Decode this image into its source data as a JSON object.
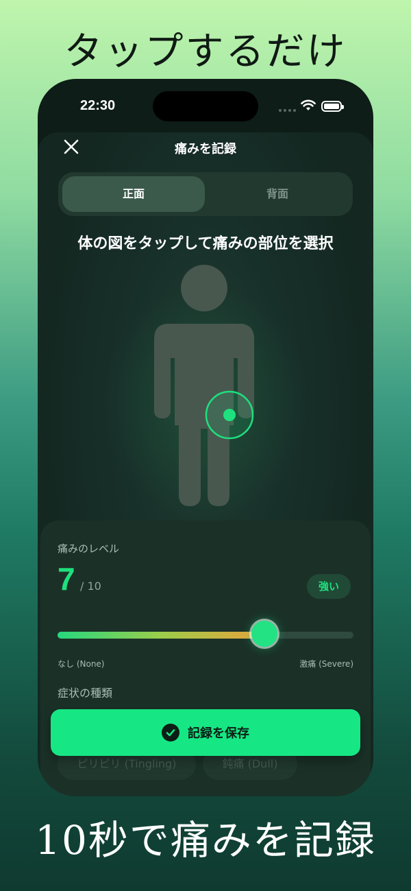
{
  "headline_top": "タップするだけ",
  "headline_bottom": "10秒で痛みを記録",
  "status_bar": {
    "time": "22:30"
  },
  "sheet": {
    "title": "痛みを記録",
    "close_icon": "close-icon"
  },
  "view_toggle": {
    "front_label": "正面",
    "back_label": "背面",
    "selected": "正面"
  },
  "instruction": "体の図をタップして痛みの部位を選択",
  "pain_level": {
    "label": "痛みのレベル",
    "value": "7",
    "max_text": "/ 10",
    "badge": "強い",
    "fraction": 0.7,
    "min_label": "なし (None)",
    "max_label": "激痛 (Severe)"
  },
  "symptoms": {
    "label": "症状の種類",
    "chips": [
      "ピリピリ (Tingling)",
      "鈍痛 (Dull)"
    ]
  },
  "save_button": {
    "label": "記録を保存",
    "icon": "checkmark-icon"
  },
  "colors": {
    "accent": "#16e784",
    "background_dark": "#0e1d17"
  }
}
